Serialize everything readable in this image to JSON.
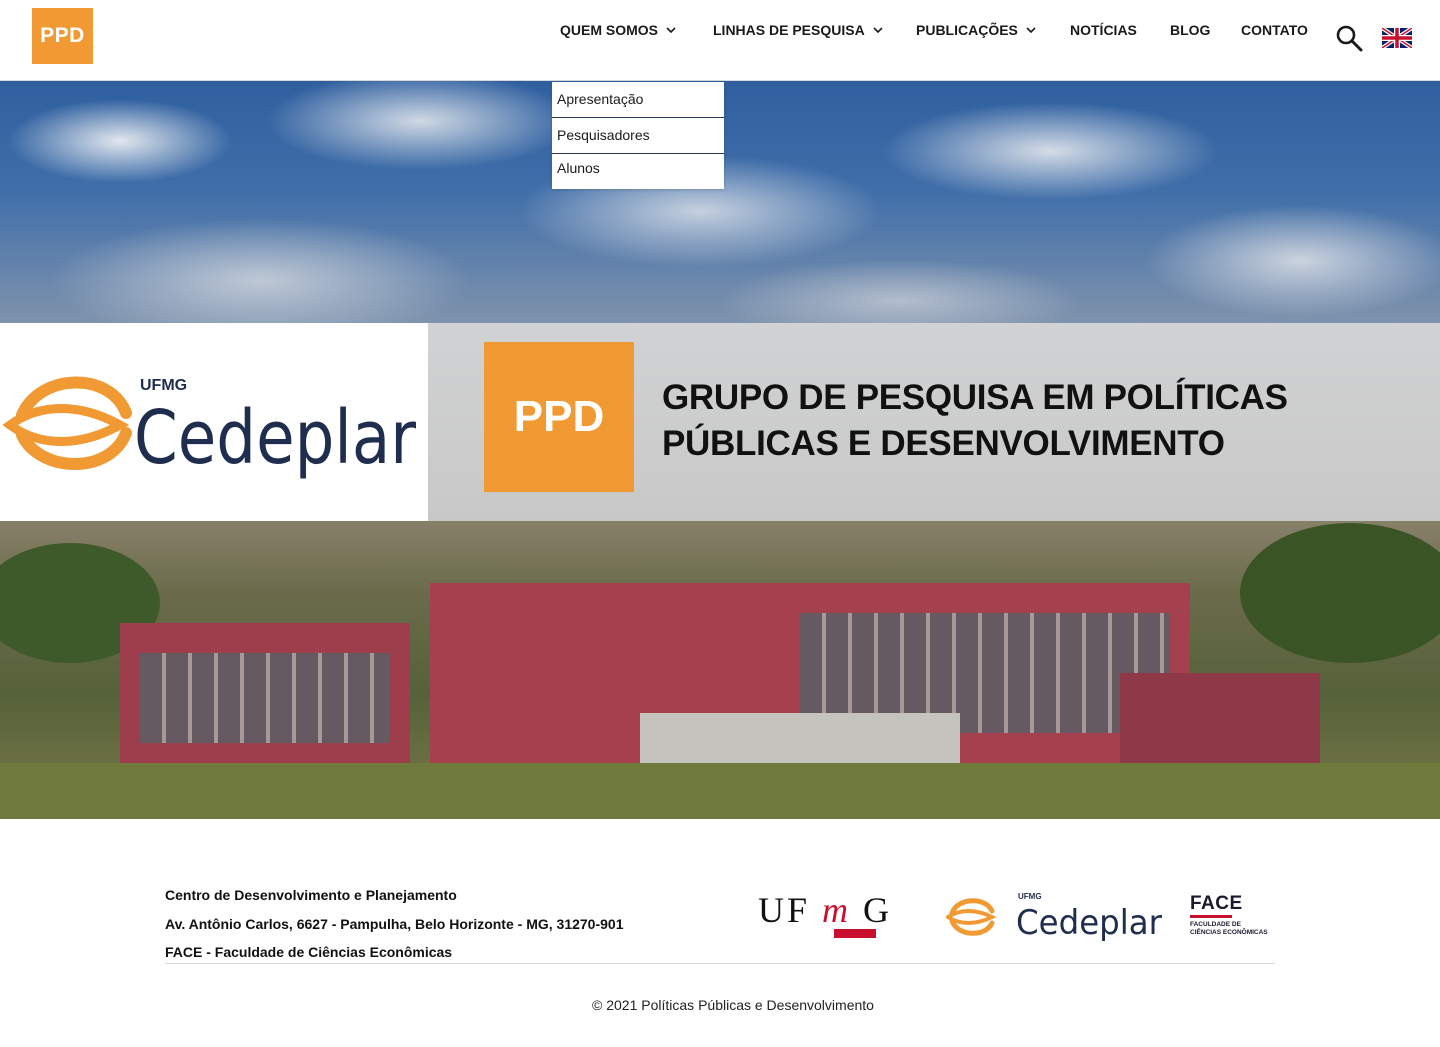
{
  "header": {
    "logo_text": "PPD",
    "nav": [
      {
        "label": "QUEM SOMOS",
        "has_dropdown": true
      },
      {
        "label": "LINHAS DE PESQUISA",
        "has_dropdown": true
      },
      {
        "label": "PUBLICAÇÕES",
        "has_dropdown": true
      },
      {
        "label": "NOTÍCIAS",
        "has_dropdown": false
      },
      {
        "label": "BLOG",
        "has_dropdown": false
      },
      {
        "label": "CONTATO",
        "has_dropdown": false
      }
    ],
    "search_icon": "search-icon",
    "language_flag": "uk-flag-icon"
  },
  "dropdown": {
    "items": [
      "Apresentação",
      "Pesquisadores",
      "Alunos"
    ]
  },
  "banner": {
    "cedeplar_sub": "UFMG",
    "cedeplar_name": "Cedeplar",
    "ppd_text": "PPD",
    "title_line1": "GRUPO DE PESQUISA EM POLÍTICAS",
    "title_line2": "PÚBLICAS E DESENVOLVIMENTO"
  },
  "footer": {
    "address_lines": [
      "Centro de Desenvolvimento e Planejamento",
      "Av. Antônio Carlos, 6627 - Pampulha, Belo Horizonte - MG, 31270-901",
      "FACE - Faculdade de Ciências Econômicas"
    ],
    "logos": {
      "ufmg_left": "UF",
      "ufmg_m": "m",
      "ufmg_right": "G",
      "cedeplar_sub": "UFMG",
      "cedeplar_name": "Cedeplar",
      "face_big": "FACE",
      "face_small_1": "FACULDADE DE",
      "face_small_2": "CIÊNCIAS ECONÔMICAS"
    },
    "copyright": "© 2021 Políticas Públicas e Desenvolvimento"
  },
  "colors": {
    "brand_orange": "#f19a34",
    "cedeplar_navy": "#1f2d4e",
    "ufmg_red": "#c8102e"
  }
}
